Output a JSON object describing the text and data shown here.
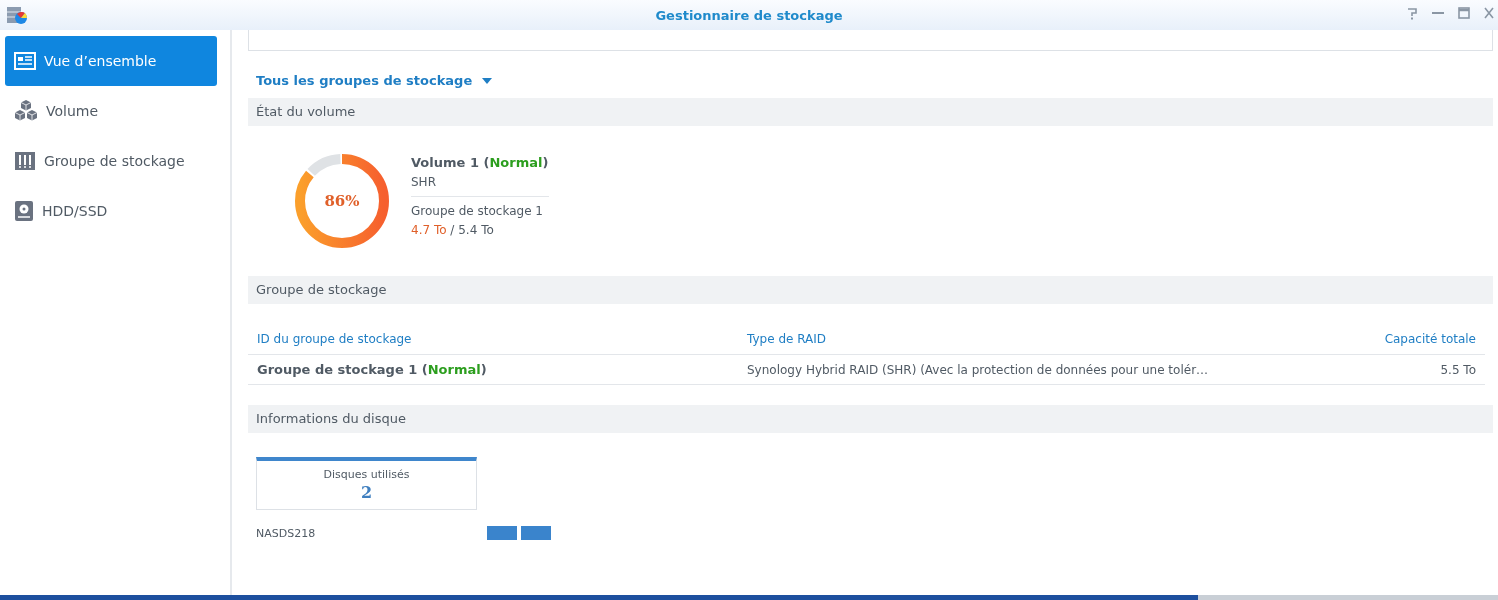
{
  "window": {
    "title": "Gestionnaire de stockage"
  },
  "sidebar": {
    "items": [
      {
        "label": "Vue d’ensemble",
        "kind": "overview",
        "selected": true
      },
      {
        "label": "Volume",
        "kind": "volume",
        "selected": false
      },
      {
        "label": "Groupe de stockage",
        "kind": "pool",
        "selected": false
      },
      {
        "label": "HDD/SSD",
        "kind": "disk",
        "selected": false
      }
    ]
  },
  "filter": {
    "label": "Tous les groupes de stockage"
  },
  "volume_status": {
    "title": "État du volume",
    "volume": {
      "percent": "86%",
      "level": 0.86,
      "name": "Volume 1 (**Normal**)",
      "type": "SHR",
      "pool": "Groupe de stockage 1",
      "used": "4.7 To",
      "separator": "/",
      "total": "5.4 To"
    }
  },
  "storage_pool": {
    "title": "Groupe de stockage",
    "table": {
      "columns": [
        "ID du groupe de stockage",
        "Type de RAID",
        "Capacité totale"
      ],
      "rows": [
        {
          "cells": [
            "Groupe de stockage 1 (**Normal**)",
            "Synology Hybrid RAID (SHR) (Avec la protection de données pour une tolér…",
            "5.5 To"
          ]
        }
      ]
    }
  },
  "disk_info": {
    "title": "Informations du disque",
    "card": {
      "label": "Disques utilisés",
      "count": "2"
    },
    "device": "NASDS218",
    "disks": [
      {
        "kind": "used"
      },
      {
        "kind": "used"
      }
    ]
  }
}
